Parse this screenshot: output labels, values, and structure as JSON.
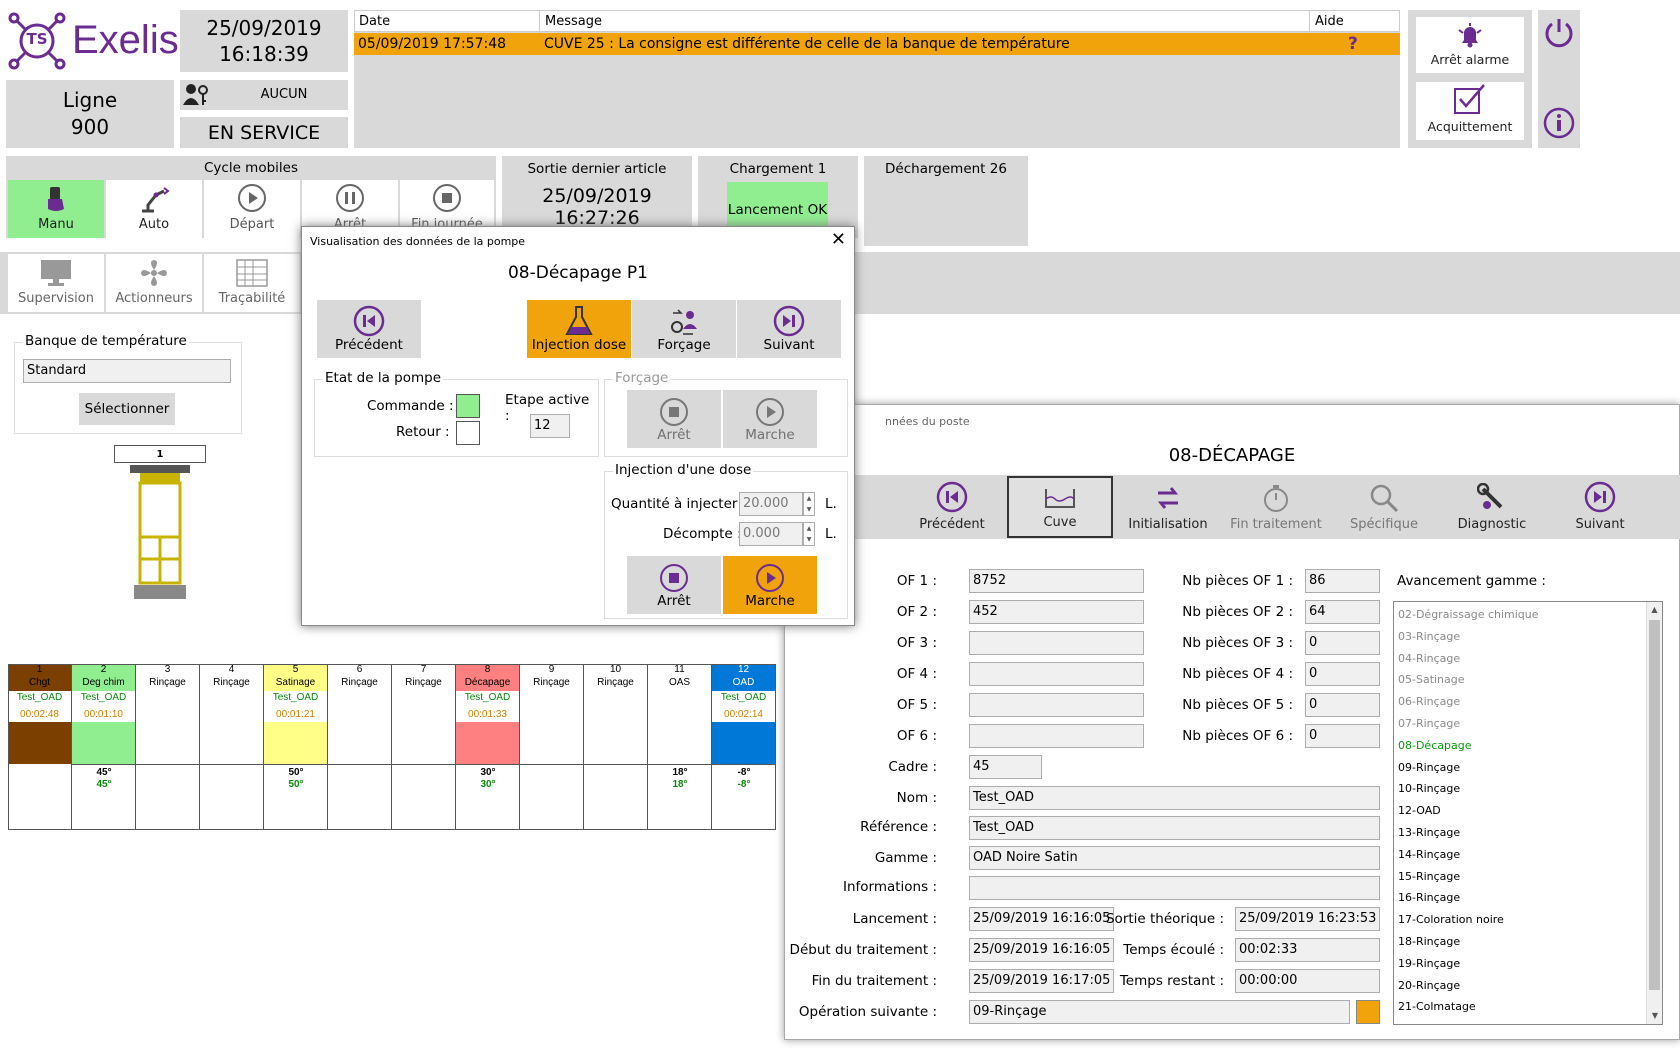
{
  "header": {
    "brand": "Exelis",
    "logo_text": "TS",
    "date": "25/09/2019",
    "time": "16:18:39",
    "line_label": "Ligne",
    "line_number": "900",
    "user": "AUCUN",
    "status": "EN SERVICE"
  },
  "alarms": {
    "columns": [
      "Date",
      "Message",
      "Aide"
    ],
    "rows": [
      {
        "date": "05/09/2019 17:57:48",
        "message": "CUVE 25 : La consigne est différente de celle de la banque de température",
        "help": "?"
      }
    ]
  },
  "right_buttons": {
    "alarm_stop": "Arrêt alarme",
    "ack": "Acquittement"
  },
  "cycle": {
    "title": "Cycle mobiles",
    "buttons": [
      "Manu",
      "Auto",
      "Départ",
      "Arrêt",
      "Fin journée"
    ]
  },
  "sortie": {
    "title": "Sortie dernier article",
    "date": "25/09/2019",
    "time": "16:27:26"
  },
  "chargement": {
    "title": "Chargement 1",
    "status": "Lancement OK"
  },
  "dechargement": {
    "title": "Déchargement 26"
  },
  "nav": [
    "Supervision",
    "Actionneurs",
    "Traçabilité"
  ],
  "bank": {
    "title": "Banque de température",
    "value": "Standard",
    "select": "Sélectionner"
  },
  "crane": {
    "label": "1"
  },
  "baths": [
    {
      "num": "1",
      "name": "Chgt",
      "lot": "Test_OAD",
      "time": "00:02:48",
      "color": "#7b3f00",
      "t1": "",
      "t2": ""
    },
    {
      "num": "2",
      "name": "Deg chim",
      "lot": "Test_OAD",
      "time": "00:01:10",
      "color": "#90ee90",
      "t1": "45°",
      "t2": "45°"
    },
    {
      "num": "3",
      "name": "Rinçage",
      "lot": "",
      "time": "",
      "color": "#ffffff",
      "t1": "",
      "t2": ""
    },
    {
      "num": "4",
      "name": "Rinçage",
      "lot": "",
      "time": "",
      "color": "#ffffff",
      "t1": "",
      "t2": ""
    },
    {
      "num": "5",
      "name": "Satinage",
      "lot": "Test_OAD",
      "time": "00:01:21",
      "color": "#ffff88",
      "t1": "50°",
      "t2": "50°"
    },
    {
      "num": "6",
      "name": "Rinçage",
      "lot": "",
      "time": "",
      "color": "#ffffff",
      "t1": "",
      "t2": ""
    },
    {
      "num": "7",
      "name": "Rinçage",
      "lot": "",
      "time": "",
      "color": "#ffffff",
      "t1": "",
      "t2": ""
    },
    {
      "num": "8",
      "name": "Décapage",
      "lot": "Test_OAD",
      "time": "00:01:33",
      "color": "#ff8080",
      "t1": "30°",
      "t2": "30°"
    },
    {
      "num": "9",
      "name": "Rinçage",
      "lot": "",
      "time": "",
      "color": "#ffffff",
      "t1": "",
      "t2": ""
    },
    {
      "num": "10",
      "name": "Rinçage",
      "lot": "",
      "time": "",
      "color": "#ffffff",
      "t1": "",
      "t2": ""
    },
    {
      "num": "11",
      "name": "OAS",
      "lot": "",
      "time": "",
      "color": "#ffffff",
      "t1": "18°",
      "t2": "18°"
    },
    {
      "num": "12",
      "name": "OAD",
      "lot": "Test_OAD",
      "time": "00:02:14",
      "color": "#0078d7",
      "t1": "-8°",
      "t2": "-8°"
    }
  ],
  "poste": {
    "title_partial": "nnées du poste",
    "name": "08-DÉCAPAGE",
    "toolbar": [
      "Précédent",
      "Cuve",
      "Initialisation",
      "Fin traitement",
      "Spécifique",
      "Diagnostic",
      "Suivant"
    ],
    "of_labels": [
      "OF 1 :",
      "OF 2 :",
      "OF 3 :",
      "OF 4 :",
      "OF 5 :",
      "OF 6 :"
    ],
    "of_values": [
      "8752",
      "452",
      "",
      "",
      "",
      ""
    ],
    "nb_labels": [
      "Nb pièces OF 1 :",
      "Nb pièces OF 2 :",
      "Nb pièces OF 3 :",
      "Nb pièces OF 4 :",
      "Nb pièces OF 5 :",
      "Nb pièces OF 6 :"
    ],
    "nb_values": [
      "86",
      "64",
      "0",
      "0",
      "0",
      "0"
    ],
    "cadre_label": "Cadre :",
    "cadre": "45",
    "nom_label": "Nom :",
    "nom": "Test_OAD",
    "ref_label": "Référence :",
    "ref": "Test_OAD",
    "gamme_label": "Gamme :",
    "gamme": "OAD Noire Satin",
    "info_label": "Informations :",
    "info": "",
    "lancement_label": "Lancement :",
    "lancement": "25/09/2019 16:16:05",
    "sortie_label": "Sortie théorique :",
    "sortie": "25/09/2019 16:23:53",
    "debut_label": "Début du traitement :",
    "debut": "25/09/2019 16:16:05",
    "ecoule_label": "Temps écoulé :",
    "ecoule": "00:02:33",
    "fin_label": "Fin du traitement :",
    "fin": "25/09/2019 16:17:05",
    "restant_label": "Temps restant :",
    "restant": "00:00:00",
    "next_label": "Opération suivante :",
    "next": "09-Rinçage",
    "avancement_label": "Avancement gamme :",
    "gamme_steps": [
      {
        "t": "02-Dégraissage chimique",
        "s": "done"
      },
      {
        "t": "03-Rinçage",
        "s": "done"
      },
      {
        "t": "04-Rinçage",
        "s": "done"
      },
      {
        "t": "05-Satinage",
        "s": "done"
      },
      {
        "t": "06-Rinçage",
        "s": "done"
      },
      {
        "t": "07-Rinçage",
        "s": "done"
      },
      {
        "t": "08-Décapage",
        "s": "cur"
      },
      {
        "t": "09-Rinçage",
        "s": "todo"
      },
      {
        "t": "10-Rinçage",
        "s": "todo"
      },
      {
        "t": "12-OAD",
        "s": "todo"
      },
      {
        "t": "13-Rinçage",
        "s": "todo"
      },
      {
        "t": "14-Rinçage",
        "s": "todo"
      },
      {
        "t": "15-Rinçage",
        "s": "todo"
      },
      {
        "t": "16-Rinçage",
        "s": "todo"
      },
      {
        "t": "17-Coloration noire",
        "s": "todo"
      },
      {
        "t": "18-Rinçage",
        "s": "todo"
      },
      {
        "t": "19-Rinçage",
        "s": "todo"
      },
      {
        "t": "20-Rinçage",
        "s": "todo"
      },
      {
        "t": "21-Colmatage",
        "s": "todo"
      }
    ]
  },
  "pump": {
    "window_title": "Visualisation des données de la pompe",
    "name": "08-Décapage P1",
    "buttons": [
      "Précédent",
      "Injection dose",
      "Forçage",
      "Suivant"
    ],
    "state_title": "Etat de la pompe",
    "commande": "Commande :",
    "retour": "Retour :",
    "etape": "Etape active :",
    "etape_val": "12",
    "forcage_title": "Forçage",
    "arret": "Arrêt",
    "marche": "Marche",
    "inject_title": "Injection d'une dose",
    "qty_label": "Quantité à injecter :",
    "qty": "20.000",
    "dec_label": "Décompte :",
    "dec": "0.000",
    "unit": "L."
  },
  "colors": {
    "accent": "#6b2c91",
    "orange": "#f0a30a",
    "green": "#90ee90"
  }
}
